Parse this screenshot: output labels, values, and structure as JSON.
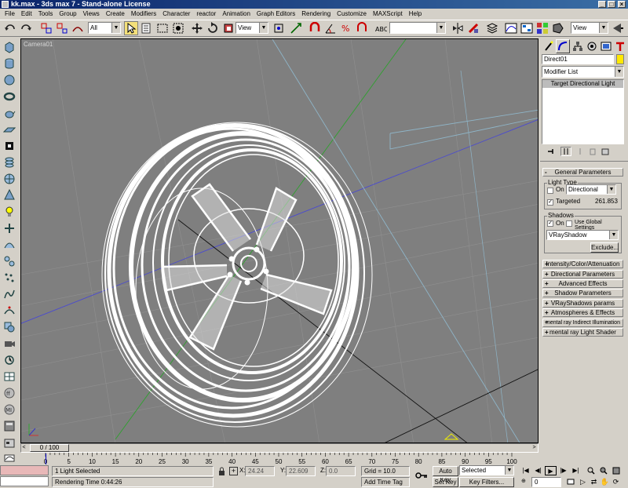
{
  "title": "kk.max - 3ds max 7 - Stand-alone License",
  "window_buttons": [
    "_",
    "□",
    "×"
  ],
  "menu": [
    "File",
    "Edit",
    "Tools",
    "Group",
    "Views",
    "Create",
    "Modifiers",
    "Character",
    "reactor",
    "Animation",
    "Graph Editors",
    "Rendering",
    "Customize",
    "MAXScript",
    "Help"
  ],
  "toolbar": {
    "selection_filter": "All",
    "ref_coord": "View",
    "named_selection": "",
    "render_view": "View"
  },
  "viewport": {
    "label": "Camera01"
  },
  "command_panel": {
    "object_name": "Direct01",
    "object_color": "#ffe800",
    "modifier_list": "Modifier List",
    "stack_item": "Target Directional Light",
    "general_parameters": "General Parameters",
    "light_type_group": "Light Type",
    "on_label": "On",
    "light_type": "Directional",
    "targeted_label": "Targeted",
    "target_distance": "261.853",
    "shadows_group": "Shadows",
    "shadows_on_label": "On",
    "use_global_label": "Use Global Settings",
    "shadow_type": "VRayShadow",
    "exclude_button": "Exclude...",
    "rollouts": [
      "Intensity/Color/Attenuation",
      "Directional Parameters",
      "Advanced Effects",
      "Shadow Parameters",
      "VRayShadows params",
      "Atmospheres & Effects",
      "mental ray Indirect Illumination",
      "mental ray Light Shader"
    ]
  },
  "timeline": {
    "frame_text": "0 / 100",
    "ticks": [
      "0",
      "5",
      "10",
      "15",
      "20",
      "25",
      "30",
      "35",
      "40",
      "45",
      "50",
      "55",
      "60",
      "65",
      "70",
      "75",
      "80",
      "85",
      "90",
      "95",
      "100"
    ]
  },
  "status": {
    "selection": "1 Light Selected",
    "prompt": "Rendering Time  0:44:26",
    "x_label": "X:",
    "x_value": "24.24",
    "y_label": "Y:",
    "y_value": "22.609",
    "z_label": "Z:",
    "z_value": "0.0",
    "grid": "Grid = 10.0",
    "add_time_tag": "Add Time Tag",
    "auto_key": "Auto Key",
    "set_key": "Set Key",
    "key_mode": "Selected",
    "key_filters": "Key Filters...",
    "current_frame": "0"
  }
}
